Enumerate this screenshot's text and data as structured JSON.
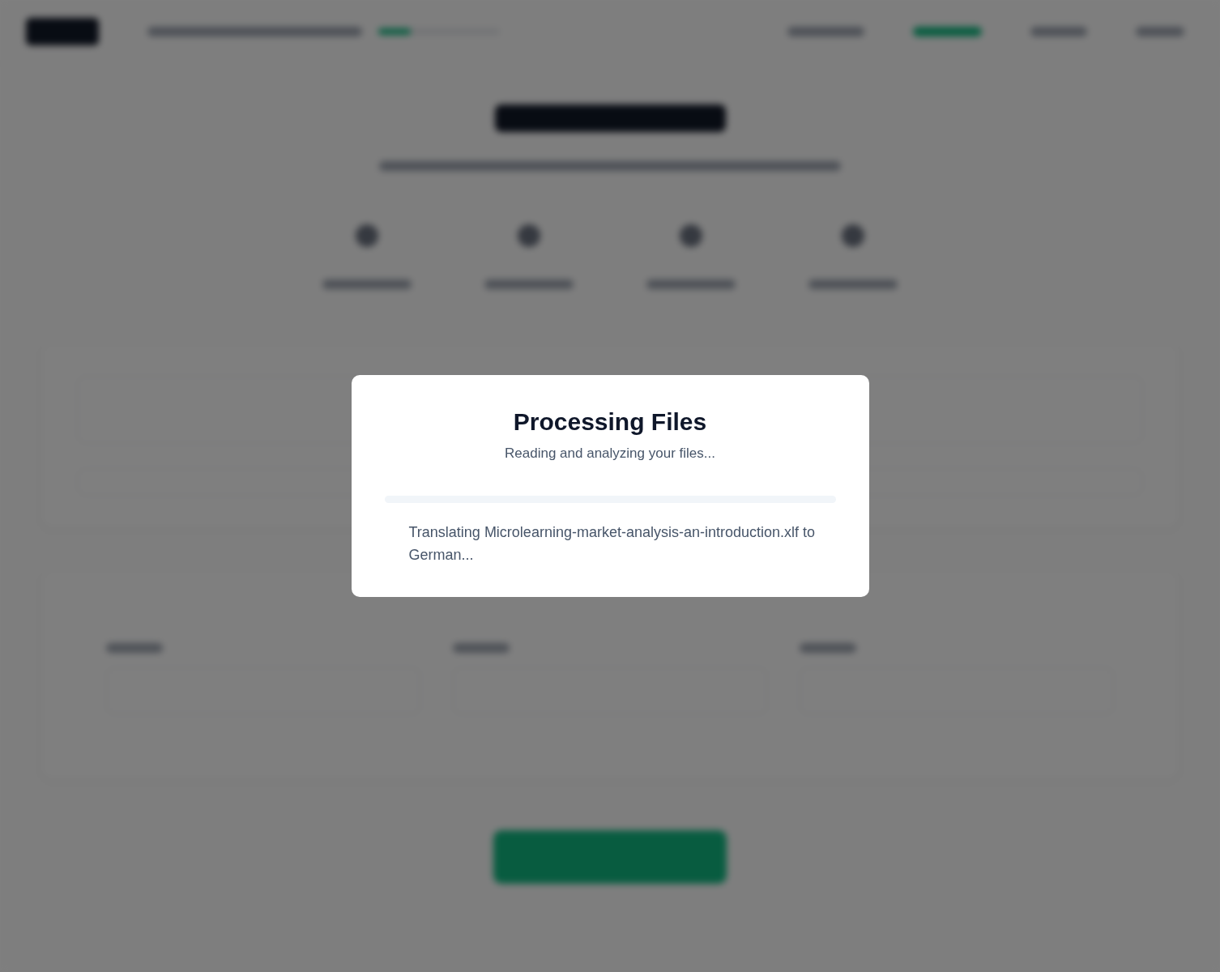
{
  "dialog": {
    "title": "Processing Files",
    "subtitle": "Reading and analyzing your files...",
    "progress": {
      "level": 0
    },
    "status": "Translating Microlearning-market-analysis-an-introduction.xlf to German..."
  }
}
